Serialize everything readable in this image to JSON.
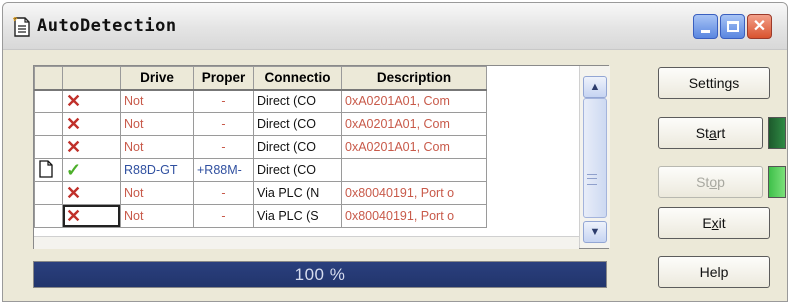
{
  "window": {
    "title": "AutoDetection"
  },
  "table": {
    "headers": [
      "",
      "",
      "Drive",
      "Proper",
      "Connectio",
      "Description"
    ],
    "rows": [
      {
        "icon": "",
        "status": "x",
        "drive": "Not",
        "property": "-",
        "connection": "Direct (CO",
        "description": "0xA0201A01, Com"
      },
      {
        "icon": "",
        "status": "x",
        "drive": "Not",
        "property": "-",
        "connection": "Direct (CO",
        "description": "0xA0201A01, Com"
      },
      {
        "icon": "",
        "status": "x",
        "drive": "Not",
        "property": "-",
        "connection": "Direct (CO",
        "description": "0xA0201A01, Com"
      },
      {
        "icon": "document",
        "status": "check",
        "drive": "R88D-GT",
        "property": "+R88M-",
        "connection": "Direct (CO",
        "description": ""
      },
      {
        "icon": "",
        "status": "x",
        "drive": "Not",
        "property": "-",
        "connection": "Via PLC (N",
        "description": "0x80040191, Port o"
      },
      {
        "icon": "",
        "status": "x",
        "drive": "Not",
        "property": "-",
        "connection": "Via PLC (S",
        "description": "0x80040191, Port o"
      }
    ]
  },
  "progress": {
    "text": "100 %",
    "fraction": 1.0
  },
  "buttons": {
    "settings": "Settings",
    "start_pre": "St",
    "start_u": "a",
    "start_post": "rt",
    "stop_pre": "St",
    "stop_u": "o",
    "stop_post": "p",
    "exit_pre": "E",
    "exit_u": "x",
    "exit_post": "it",
    "help": "Help"
  },
  "icons": {
    "title": "document-icon",
    "minimize": "minimize-icon",
    "maximize": "maximize-icon",
    "close": "close-icon",
    "scroll_up": "chevron-up-icon",
    "scroll_down": "chevron-down-icon",
    "error_mark": "x-mark-icon",
    "ok_mark": "check-mark-icon"
  },
  "colors": {
    "error_text": "#c85a4a",
    "ok_text": "#3050a0",
    "progress_fill": "#2a3f7e",
    "start_led": "#1d5a2c",
    "stop_led": "#3fc04a"
  }
}
